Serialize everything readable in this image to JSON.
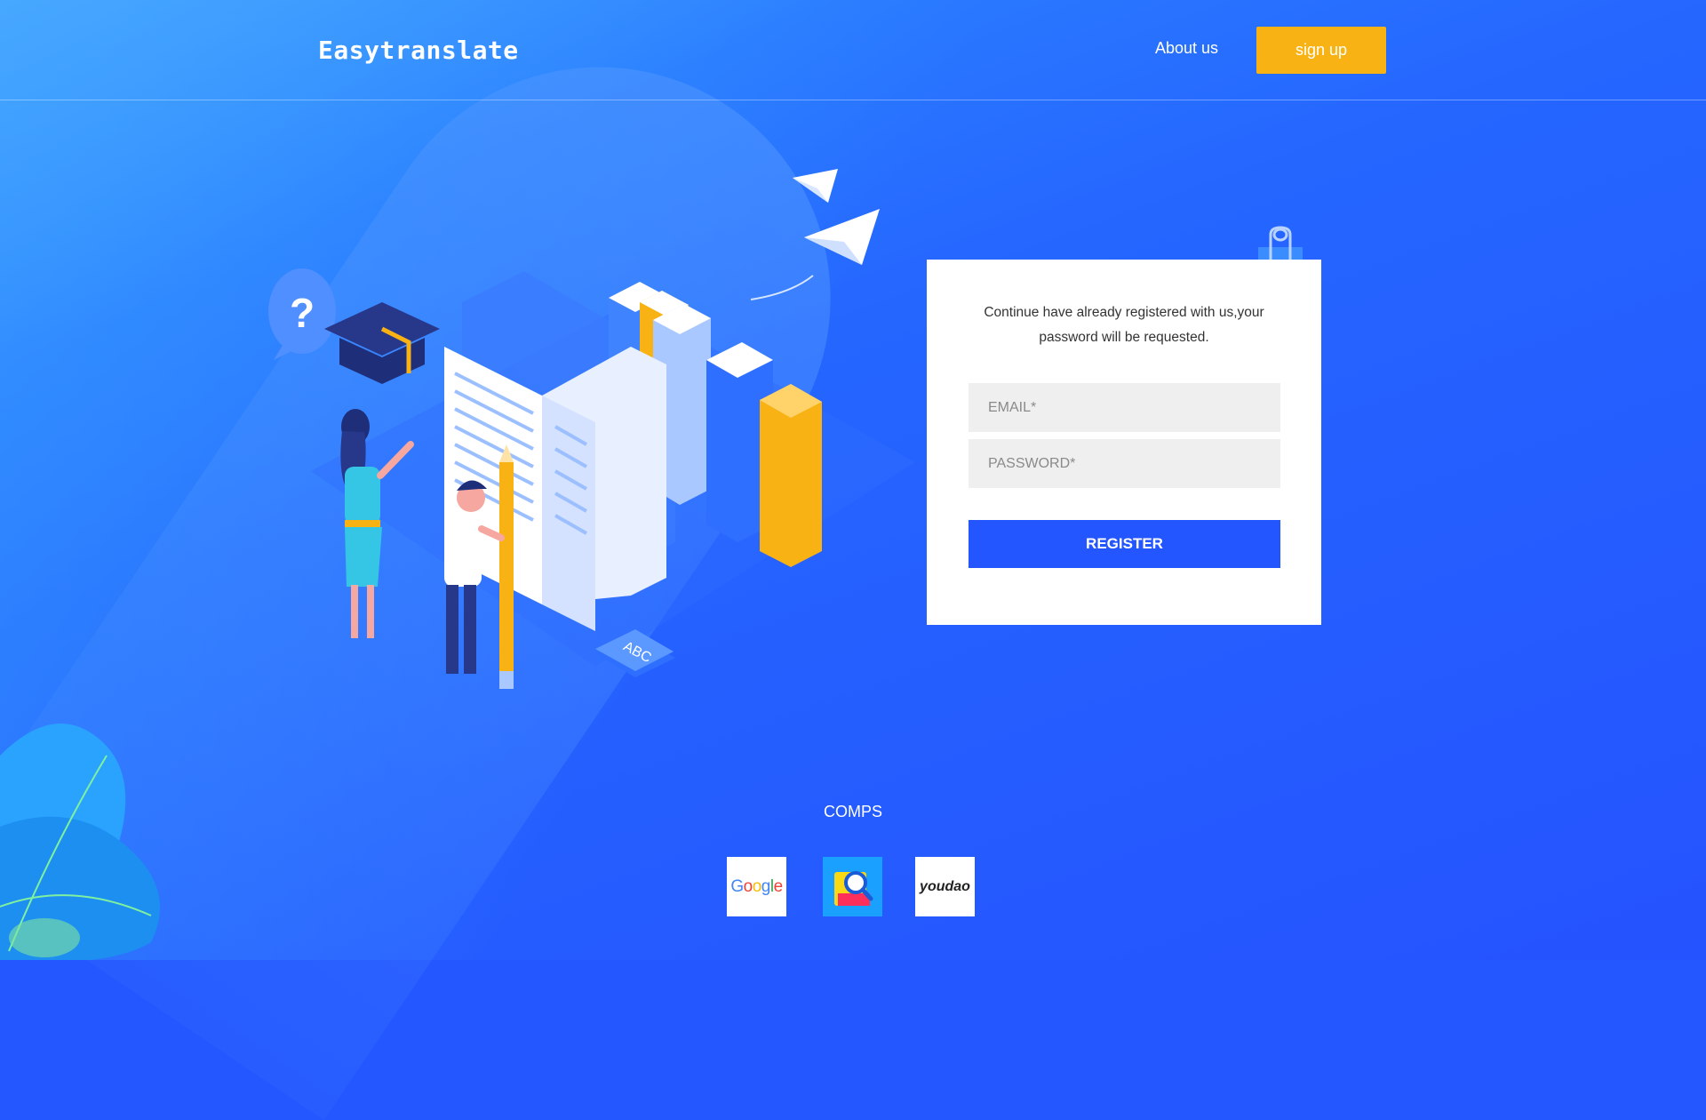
{
  "header": {
    "logo": "Easytranslate",
    "nav_about": "About us",
    "signup_label": "sign up"
  },
  "form": {
    "description": "Continue have already registered with us,your password will be requested.",
    "email_placeholder": "EMAIL*",
    "password_placeholder": "PASSWORD*",
    "register_label": "REGISTER"
  },
  "illustration": {
    "abc_label": "ABC",
    "question_mark": "?"
  },
  "comps": {
    "title": "COMPS",
    "items": [
      {
        "name": "Google",
        "label": "Google"
      },
      {
        "name": "search-app",
        "label": ""
      },
      {
        "name": "youdao",
        "label": "youdao"
      }
    ]
  },
  "colors": {
    "accent_blue": "#2456ff",
    "signup_yellow": "#f9b214",
    "card_bg": "#ffffff",
    "field_bg": "#efefef"
  }
}
